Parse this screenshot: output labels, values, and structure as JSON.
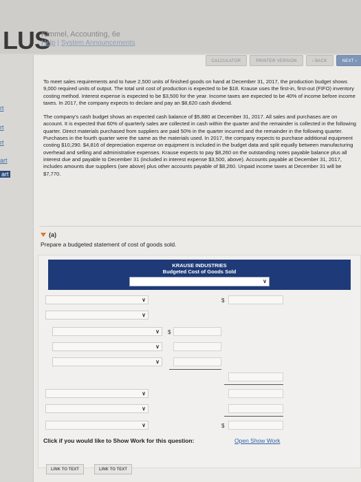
{
  "header": {
    "logo": "LUS",
    "course": "Kimmel, Accounting, 6e",
    "links": [
      "Help",
      "System Announcements"
    ]
  },
  "left_rail": [
    "rt",
    "rt",
    "rt",
    "art",
    "art"
  ],
  "toolbar": {
    "calculator": "CALCULATOR",
    "printer": "PRINTER VERSION",
    "back": "‹ BACK",
    "next": "NEXT ›"
  },
  "problem": {
    "paragraph1": "To meet sales requirements and to have 2,500 units of finished goods on hand at December 31, 2017, the production budget shows 9,000 required units of output. The total unit cost of production is expected to be $18. Krause uses the first-in, first-out (FIFO) inventory costing method. Interest expense is expected to be $3,500 for the year. Income taxes are expected to be 40% of income before income taxes. In 2017, the company expects to declare and pay an $8,620 cash dividend.",
    "paragraph2": "The company's cash budget shows an expected cash balance of $5,880 at December 31, 2017. All sales and purchases are on account. It is expected that 60% of quarterly sales are collected in cash within the quarter and the remainder is collected in the following quarter. Direct materials purchased from suppliers are paid 50% in the quarter incurred and the remainder in the following quarter. Purchases in the fourth quarter were the same as the materials used. In 2017, the company expects to purchase additional equipment costing $10,290. $4,816 of depreciation expense on equipment is included in the budget data and split equally between manufacturing overhead and selling and administrative expenses. Krause expects to pay $8,260 on the outstanding notes payable balance plus all interest due and payable to December 31 (included in interest expense $3,500, above). Accounts payable at December 31, 2017, includes amounts due suppliers (see above) plus other accounts payable of $8,260. Unpaid income taxes at December 31 will be $7,770."
  },
  "part": {
    "label": "(a)",
    "instruction": "Prepare a budgeted statement of cost of goods sold."
  },
  "statement": {
    "company": "KRAUSE INDUSTRIES",
    "title": "Budgeted Cost of Goods Sold",
    "period_value": "",
    "dollar": "$",
    "chevron": "∨"
  },
  "footer": {
    "show_work_prompt": "Click if you would like to Show Work for this question:",
    "show_work_link": "Open Show Work",
    "link_to_text_1": "LINK TO TEXT",
    "link_to_text_2": "LINK TO TEXT"
  }
}
